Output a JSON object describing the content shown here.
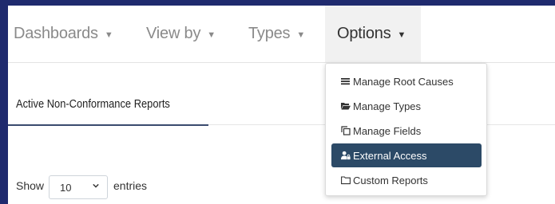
{
  "nav": {
    "dashboards": "Dashboards",
    "view_by": "View by",
    "types": "Types",
    "options": "Options",
    "caret": "▼"
  },
  "card": {
    "title": "Active Non-Conformance Reports"
  },
  "table_controls": {
    "show_label": "Show",
    "entries_value": "10",
    "entries_label": "entries"
  },
  "options_menu": {
    "items": [
      {
        "label": "Manage Root Causes",
        "icon": "bars-icon"
      },
      {
        "label": "Manage Types",
        "icon": "folder-open-icon"
      },
      {
        "label": "Manage Fields",
        "icon": "clone-icon"
      },
      {
        "label": "External Access",
        "icon": "user-lock-icon",
        "highlighted": true
      },
      {
        "label": "Custom Reports",
        "icon": "folder-icon"
      }
    ]
  },
  "colors": {
    "outer_background": "#1f2a6e",
    "highlight": "#2c4a67"
  }
}
